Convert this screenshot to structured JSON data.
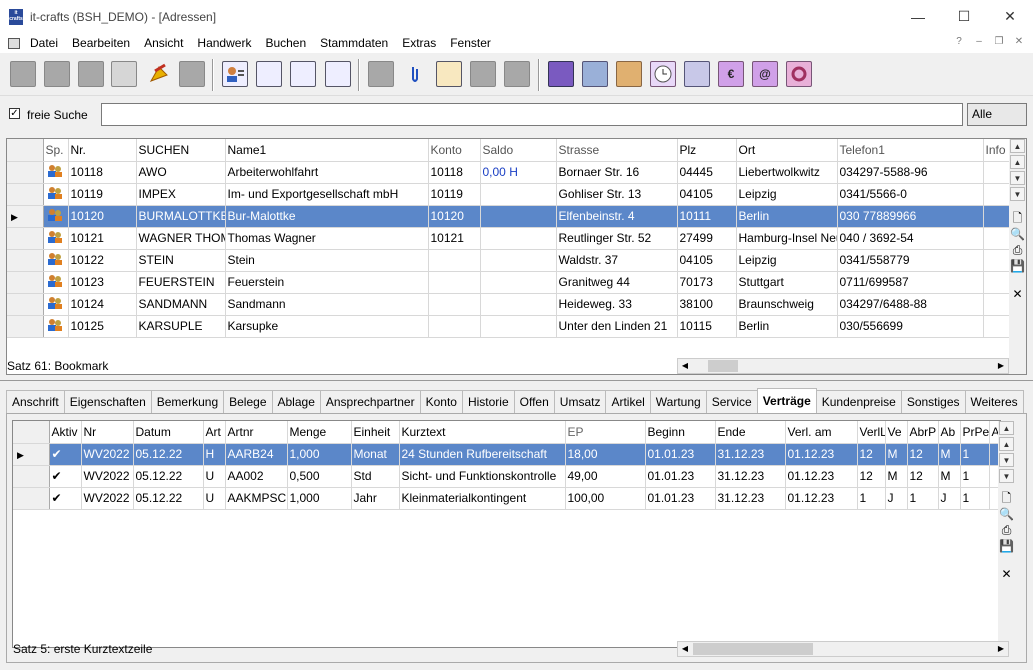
{
  "window": {
    "logo_text": "it crafts",
    "title": "it-crafts (BSH_DEMO) - [Adressen]",
    "min": "—",
    "max": "☐",
    "close": "✕"
  },
  "menu": {
    "items": [
      "Datei",
      "Bearbeiten",
      "Ansicht",
      "Handwerk",
      "Buchen",
      "Stammdaten",
      "Extras",
      "Fenster"
    ],
    "help": "?",
    "mdi_min": "–",
    "mdi_restore": "❐",
    "mdi_close": "✕"
  },
  "toolbar": {
    "icons": [
      "new-icon",
      "edit-icon",
      "save-icon",
      "print-icon",
      "export-icon",
      "delete-icon",
      "address-card-icon",
      "document-icon",
      "calendar-note-icon",
      "settings-list-icon",
      "list-icon",
      "paperclip-icon",
      "columns-icon",
      "folder-arrow-icon",
      "form-icon",
      "book-icon",
      "people-icon",
      "boxes-icon",
      "clock-icon",
      "tools-icon",
      "euro-icon",
      "at-icon",
      "gear-icon"
    ]
  },
  "search": {
    "checkbox_label": "freie Suche",
    "checked": true,
    "value": "",
    "filter": "Alle"
  },
  "addresses": {
    "columns": [
      "Sp.",
      "Nr.",
      "SUCHEN",
      "Name1",
      "Konto",
      "Saldo",
      "Strasse",
      "Plz",
      "Ort",
      "Telefon1",
      "Info"
    ],
    "rows": [
      {
        "nr": "10118",
        "suchen": "AWO",
        "name1": "Arbeiterwohlfahrt",
        "konto": "10118",
        "saldo": "0,00 H",
        "strasse": "Bornaer Str. 16",
        "plz": "04445",
        "ort": "Liebertwolkwitz",
        "telefon": "034297-5588-96",
        "info": ""
      },
      {
        "nr": "10119",
        "suchen": "IMPEX",
        "name1": "Im- und Exportgesellschaft mbH",
        "konto": "10119",
        "saldo": "",
        "strasse": "Gohliser Str. 13",
        "plz": "04105",
        "ort": "Leipzig",
        "telefon": "0341/5566-0",
        "info": ""
      },
      {
        "nr": "10120",
        "suchen": "BURMALOTTKE",
        "name1": "Bur-Malottke",
        "konto": "10120",
        "saldo": "",
        "strasse": "Elfenbeinstr. 4",
        "plz": "10111",
        "ort": "Berlin",
        "telefon": "030 77889966",
        "info": ""
      },
      {
        "nr": "10121",
        "suchen": "WAGNER THOM",
        "name1": "Thomas Wagner",
        "konto": "10121",
        "saldo": "",
        "strasse": "Reutlinger Str. 52",
        "plz": "27499",
        "ort": "Hamburg-Insel Neuw",
        "telefon": "040 / 3692-54",
        "info": ""
      },
      {
        "nr": "10122",
        "suchen": "STEIN",
        "name1": "Stein",
        "konto": "",
        "saldo": "",
        "strasse": "Waldstr. 37",
        "plz": "04105",
        "ort": "Leipzig",
        "telefon": "0341/558779",
        "info": ""
      },
      {
        "nr": "10123",
        "suchen": "FEUERSTEIN",
        "name1": "Feuerstein",
        "konto": "",
        "saldo": "",
        "strasse": "Granitweg 44",
        "plz": "70173",
        "ort": "Stuttgart",
        "telefon": "0711/699587",
        "info": ""
      },
      {
        "nr": "10124",
        "suchen": "SANDMANN",
        "name1": "Sandmann",
        "konto": "",
        "saldo": "",
        "strasse": "Heideweg. 33",
        "plz": "38100",
        "ort": "Braunschweig",
        "telefon": "034297/6488-88",
        "info": ""
      },
      {
        "nr": "10125",
        "suchen": "KARSUPLE",
        "name1": "Karsupke",
        "konto": "",
        "saldo": "",
        "strasse": "Unter den Linden 21",
        "plz": "10115",
        "ort": "Berlin",
        "telefon": "030/556699",
        "info": ""
      }
    ],
    "status": "Satz 61: Bookmark"
  },
  "tabs": [
    "Anschrift",
    "Eigenschaften",
    "Bemerkung",
    "Belege",
    "Ablage",
    "Ansprechpartner",
    "Konto",
    "Historie",
    "Offen",
    "Umsatz",
    "Artikel",
    "Wartung",
    "Service",
    "Verträge",
    "Kundenpreise",
    "Sonstiges",
    "Weiteres"
  ],
  "active_tab": "Verträge",
  "contracts": {
    "columns": [
      "Aktiv",
      "Nr",
      "Datum",
      "Art",
      "Artnr",
      "Menge",
      "Einheit",
      "Kurztext",
      "EP",
      "Beginn",
      "Ende",
      "Verl. am",
      "VerlL",
      "Ve",
      "AbrP",
      "Ab",
      "PrPe",
      "A"
    ],
    "rows": [
      {
        "aktiv": "✔",
        "nr": "WV2022",
        "datum": "05.12.22",
        "art": "H",
        "artnr": "AARB24",
        "menge": "1,000",
        "einheit": "Monat",
        "kurztext": "24 Stunden Rufbereitschaft",
        "ep": "18,00",
        "beginn": "01.01.23",
        "ende": "31.12.23",
        "verl": "01.12.23",
        "verll": "12",
        "ve": "M",
        "abrp": "12",
        "ab": "M",
        "prpe": "1"
      },
      {
        "aktiv": "✔",
        "nr": "WV2022",
        "datum": "05.12.22",
        "art": "U",
        "artnr": "AA002",
        "menge": "0,500",
        "einheit": "Std",
        "kurztext": "Sicht- und Funktionskontrolle",
        "ep": "49,00",
        "beginn": "01.01.23",
        "ende": "31.12.23",
        "verl": "01.12.23",
        "verll": "12",
        "ve": "M",
        "abrp": "12",
        "ab": "M",
        "prpe": "1"
      },
      {
        "aktiv": "✔",
        "nr": "WV2022",
        "datum": "05.12.22",
        "art": "U",
        "artnr": "AAKMPSCH",
        "menge": "1,000",
        "einheit": "Jahr",
        "kurztext": "Kleinmaterialkontingent",
        "ep": "100,00",
        "beginn": "01.01.23",
        "ende": "31.12.23",
        "verl": "01.12.23",
        "verll": "1",
        "ve": "J",
        "abrp": "1",
        "ab": "J",
        "prpe": "1"
      }
    ],
    "status": "Satz 5: erste Kurztextzeile"
  },
  "colors": {
    "selection": "#5b87c9",
    "accent_blue": "#1a3fc4"
  }
}
